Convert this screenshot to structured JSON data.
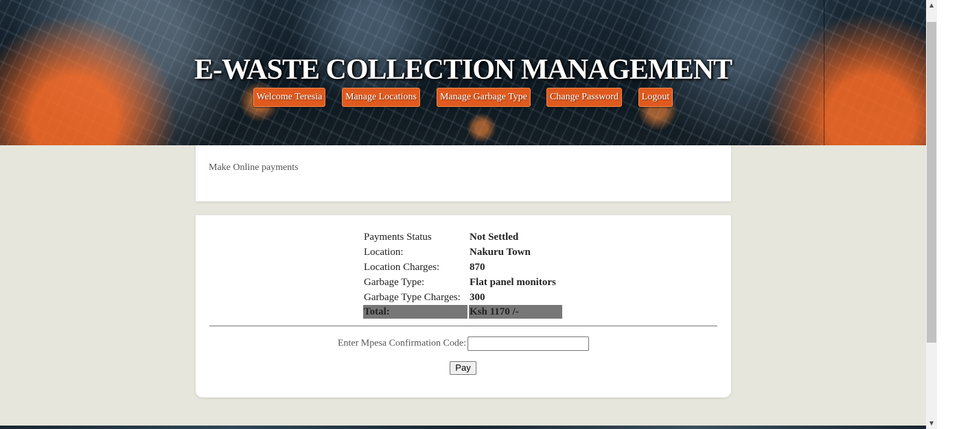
{
  "header": {
    "title": "E-WASTE COLLECTION MANAGEMENT",
    "nav": [
      {
        "label": "Welcome Teresia"
      },
      {
        "label": "Manage Locations"
      },
      {
        "label": "Manage Garbage Type"
      },
      {
        "label": "Change Password"
      },
      {
        "label": "Logout"
      }
    ]
  },
  "intro": {
    "text": "Make Online payments"
  },
  "summary": {
    "rows": [
      {
        "label": "Payments Status",
        "value": "Not Settled"
      },
      {
        "label": "Location:",
        "value": "Nakuru Town"
      },
      {
        "label": "Location Charges:",
        "value": "870"
      },
      {
        "label": "Garbage Type:",
        "value": "Flat panel monitors"
      },
      {
        "label": "Garbage Type Charges:",
        "value": "300"
      }
    ],
    "total": {
      "label": "Total:",
      "value": "Ksh 1170 /-"
    }
  },
  "payment": {
    "prompt": "Enter Mpesa Confirmation Code:",
    "code_value": "",
    "pay_label": "Pay"
  },
  "colors": {
    "nav_button": "#e05a1e",
    "page_background": "#e6e6dc",
    "total_row": "#777777"
  }
}
